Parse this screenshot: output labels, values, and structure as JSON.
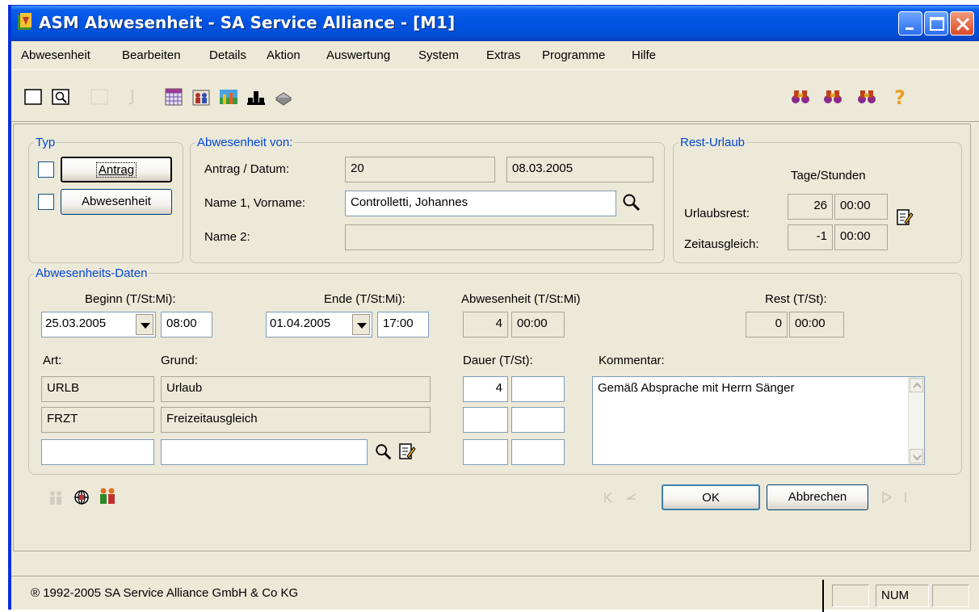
{
  "window": {
    "title": "ASM Abwesenheit - SA Service Alliance  - [M1]"
  },
  "menu": [
    "Abwesenheit",
    "Bearbeiten",
    "Details",
    "Aktion",
    "Auswertung",
    "System",
    "Extras",
    "Programme",
    "Hilfe"
  ],
  "toolbar": {
    "left_icons": [
      "new-document-icon",
      "search-document-icon",
      "blank-icon",
      "cut-icon",
      "calendar-grid-icon",
      "people-icon",
      "chart-image-icon",
      "organization-icon",
      "printer-icon"
    ],
    "right_icons": [
      "binoculars-first-icon",
      "binoculars-next-icon",
      "binoculars-last-icon",
      "help-question-icon"
    ]
  },
  "typ": {
    "legend": "Typ",
    "antrag_label": "Antrag",
    "abwesenheit_label": "Abwesenheit"
  },
  "von": {
    "legend": "Abwesenheit von:",
    "antrag_datum_label": "Antrag / Datum:",
    "antrag_nr": "20",
    "datum": "08.03.2005",
    "name1_label": "Name 1, Vorname:",
    "name1": "Controlletti, Johannes",
    "name2_label": "Name 2:",
    "name2": ""
  },
  "rest_urlaub": {
    "legend": "Rest-Urlaub",
    "header": "Tage/Stunden",
    "urlaubsrest_label": "Urlaubsrest:",
    "urlaubsrest_tage": "26",
    "urlaubsrest_stunden": "00:00",
    "zeitausgleich_label": "Zeitausgleich:",
    "zeitausgleich_tage": "-1",
    "zeitausgleich_stunden": "00:00"
  },
  "daten": {
    "legend": "Abwesenheits-Daten",
    "beginn_label": "Beginn (T/St:Mi):",
    "beginn_datum": "25.03.2005",
    "beginn_zeit": "08:00",
    "ende_label": "Ende (T/St:Mi):",
    "ende_datum": "01.04.2005",
    "ende_zeit": "17:00",
    "abwesenheit_label": "Abwesenheit (T/St:Mi)",
    "abwesenheit_tage": "4",
    "abwesenheit_zeit": "00:00",
    "rest_label": "Rest (T/St):",
    "rest_tage": "0",
    "rest_zeit": "00:00",
    "art_label": "Art:",
    "grund_label": "Grund:",
    "dauer_label": "Dauer (T/St):",
    "kommentar_label": "Kommentar:",
    "rows": [
      {
        "art": "URLB",
        "grund": "Urlaub",
        "tage": "4",
        "stunden": ""
      },
      {
        "art": "FRZT",
        "grund": "Freizeitausgleich",
        "tage": "",
        "stunden": ""
      },
      {
        "art": "",
        "grund": "",
        "tage": "",
        "stunden": ""
      }
    ],
    "kommentar": "Gemäß Absprache mit Herrn Sänger"
  },
  "buttons": {
    "ok": "OK",
    "abbrechen": "Abbrechen"
  },
  "statusbar": {
    "copyright": "® 1992-2005  SA Service Alliance GmbH & Co KG",
    "num": "NUM"
  }
}
